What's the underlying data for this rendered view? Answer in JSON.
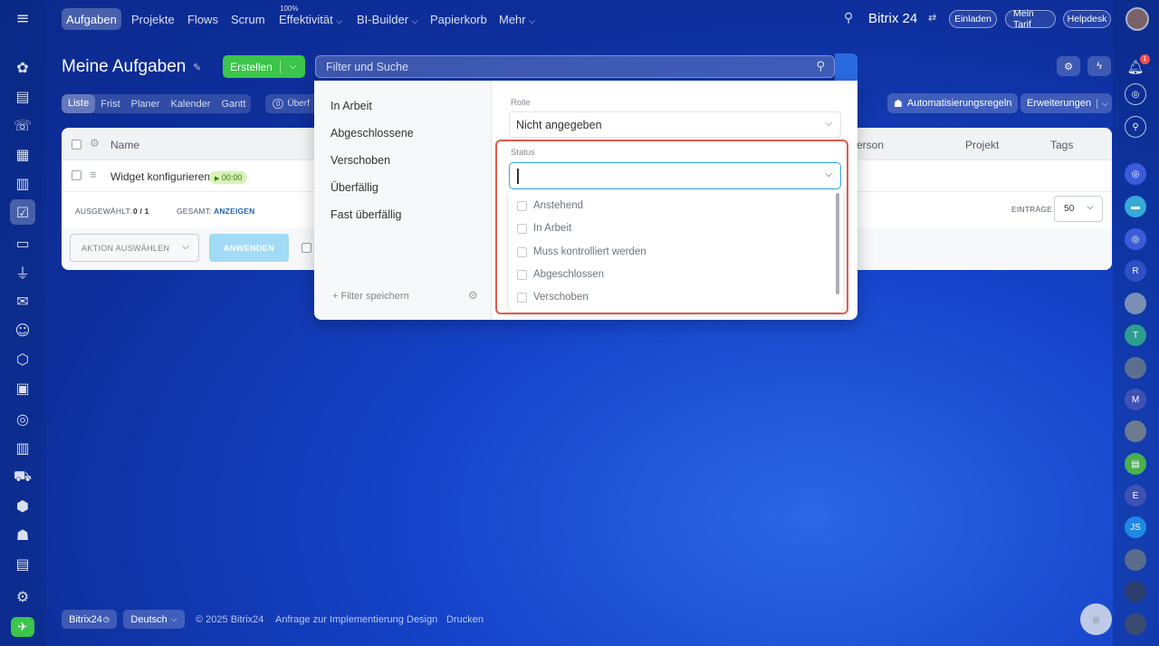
{
  "topnav": {
    "items": [
      "Aufgaben",
      "Projekte",
      "Flows",
      "Scrum",
      "Effektivität",
      "BI-Builder",
      "Papierkorb",
      "Mehr"
    ],
    "efficiency_value": "100%",
    "logo": "Bitrix 24",
    "buttons": [
      "Einladen",
      "Mein Tarif",
      "Helpdesk"
    ]
  },
  "page": {
    "title": "Meine Aufgaben",
    "create_label": "Erstellen",
    "search_placeholder": "Filter und Suche"
  },
  "viewtabs": [
    "Liste",
    "Frist",
    "Planer",
    "Kalender",
    "Gantt"
  ],
  "counter": {
    "count": "0",
    "label": "Überf"
  },
  "right_buttons": {
    "automation": "Automatisierungsregeln",
    "extensions": "Erweiterungen"
  },
  "grid": {
    "columns": {
      "name": "Name",
      "person": "erson",
      "project": "Projekt",
      "tags": "Tags"
    },
    "row": {
      "title": "Widget konfigurieren",
      "timer": "00:00"
    },
    "footer": {
      "selected_label": "AUSGEWÄHLT:",
      "selected_value": "0 / 1",
      "total_label": "GESAMT:",
      "total_link": "ANZEIGEN",
      "entries_label": "EINTRÄGE",
      "entries_value": "50"
    },
    "action_select": "AKTION AUSWÄHLEN",
    "apply": "ANWENDEN"
  },
  "footer": {
    "brand": "Bitrix24",
    "language": "Deutsch",
    "copyright": "© 2025 Bitrix24",
    "links": [
      "Anfrage zur Implementierung",
      "Design",
      "Drucken"
    ]
  },
  "filter_popup": {
    "presets": [
      "In Arbeit",
      "Abgeschlossene",
      "Verschoben",
      "Überfällig",
      "Fast überfällig"
    ],
    "save_filter": "Filter speichern",
    "role_label": "Rolle",
    "role_value": "Nicht angegeben",
    "status_label": "Status",
    "status_options": [
      "Anstehend",
      "In Arbeit",
      "Muss kontrolliert werden",
      "Abgeschlossen",
      "Verschoben"
    ]
  },
  "right_avatars": [
    "R",
    "T",
    "M",
    "E",
    "JS"
  ],
  "notification_count": "1",
  "colors": {
    "accent_green": "#3bc54a",
    "highlight_red": "#e05a4f",
    "focus_blue": "#2fa7e6"
  }
}
